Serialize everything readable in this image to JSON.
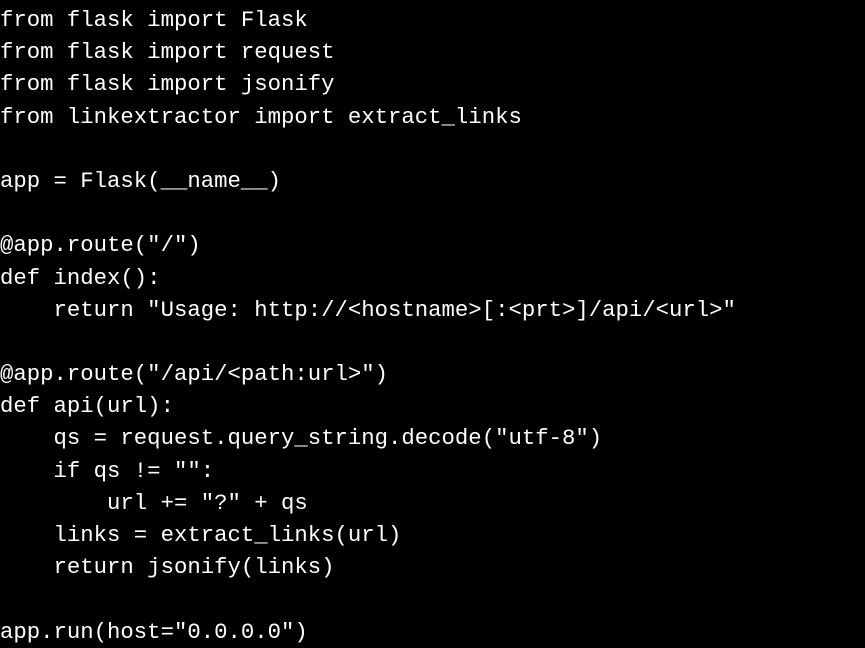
{
  "editor": {
    "background": "#000000",
    "text_color": "#ffffff",
    "lines": [
      "from flask import Flask",
      "from flask import request",
      "from flask import jsonify",
      "from linkextractor import extract_links",
      "",
      "app = Flask(__name__)",
      "",
      "@app.route(\"/\")",
      "def index():",
      "    return \"Usage: http://<hostname>[:<prt>]/api/<url>\"",
      "",
      "@app.route(\"/api/<path:url>\")",
      "def api(url):",
      "    qs = request.query_string.decode(\"utf-8\")",
      "    if qs != \"\":",
      "        url += \"?\" + qs",
      "    links = extract_links(url)",
      "    return jsonify(links)",
      "",
      "app.run(host=\"0.0.0.0\")"
    ]
  }
}
